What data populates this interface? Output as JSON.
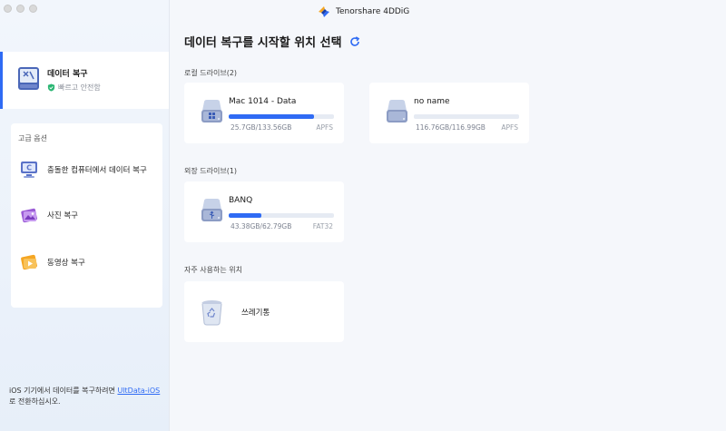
{
  "app": {
    "brand": "Tenorshare 4DDiG"
  },
  "sidebar": {
    "recover": {
      "title": "데이터 복구",
      "subtitle": "빠르고 안전함"
    },
    "advanced": {
      "title": "고급 옵션",
      "items": [
        {
          "label": "충돌한 컴퓨터에서 데이터 복구",
          "icon": "computer-c-icon"
        },
        {
          "label": "사진 복구",
          "icon": "photo-icon"
        },
        {
          "label": "동영상 복구",
          "icon": "video-icon"
        }
      ]
    },
    "ios_note": {
      "text_before": "iOS 기기에서 데이터를 복구하려면 ",
      "link": "UltData-iOS",
      "text_after": "로 전환하십시오."
    }
  },
  "main": {
    "title": "데이터 복구를 시작할 위치 선택",
    "local": {
      "label": "로컬 드라이브(2)",
      "drives": [
        {
          "name": "Mac 1014 - Data",
          "size": "25.7GB/133.56GB",
          "fs": "APFS",
          "used_fraction": 0.81
        },
        {
          "name": "no name",
          "size": "116.76GB/116.99GB",
          "fs": "APFS",
          "used_fraction": 0.0
        }
      ]
    },
    "external": {
      "label": "외장 드라이브(1)",
      "drives": [
        {
          "name": "BANQ",
          "size": "43.38GB/62.79GB",
          "fs": "FAT32",
          "used_fraction": 0.31
        }
      ]
    },
    "frequent": {
      "label": "자주 사용하는 위치",
      "items": [
        {
          "name": "쓰레기통"
        }
      ]
    }
  },
  "colors": {
    "accent": "#2f6bf4",
    "bar_bg": "#e6ebf3"
  }
}
